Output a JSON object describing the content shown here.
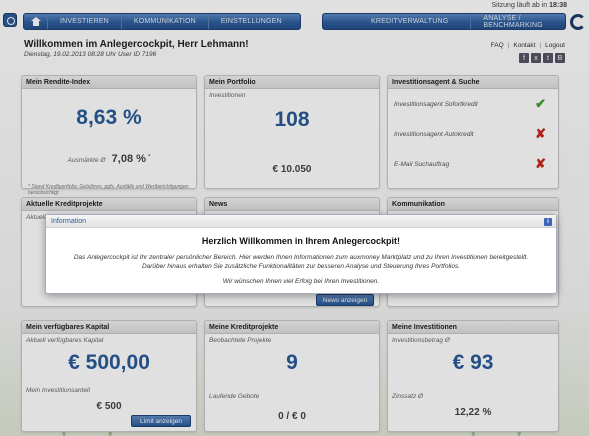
{
  "session": {
    "text": "Sitzung läuft ab in",
    "time": "18:38"
  },
  "nav": {
    "left": [
      "INVESTIEREN",
      "KOMMUNIKATION",
      "EINSTELLUNGEN"
    ],
    "right": [
      "KREDITVERWALTUNG",
      "ANALYSE / BENCHMARKING"
    ]
  },
  "header": {
    "welcome": "Willkommen im Anlegercockpit, Herr Lehmann!",
    "subline": "Dienstag, 19.02.2013 08:28 Uhr    User ID 7196",
    "links": [
      "FAQ",
      "Kontakt",
      "Logout"
    ],
    "social": [
      "f",
      "x",
      "t",
      "B"
    ]
  },
  "cards": {
    "rendite": {
      "title": "Mein Rendite-Index",
      "value": "8,63 %",
      "avg_label": "Ausmärkte Ø",
      "avg_value": "7,08 %",
      "avg_sup": "*",
      "footnote": "* Stand Kreditportfolio; Gebühren, ggfs. Ausfälle und Wertberichtigungen berücksichtigt"
    },
    "portfolio": {
      "title": "Mein Portfolio",
      "label": "Investitionen",
      "count": "108",
      "amount": "€ 10.050"
    },
    "agent": {
      "title": "Investitionsagent & Suche",
      "rows": [
        {
          "label": "Investitionsagent Sofortkredit",
          "status": "check"
        },
        {
          "label": "Investitionsagent Autokredit",
          "status": "cross"
        },
        {
          "label": "E-Mail Suchauftrag",
          "status": "cross"
        }
      ]
    },
    "kreditprojekte": {
      "title": "Aktuelle Kreditprojekte",
      "label": "Aktuell"
    },
    "news": {
      "title": "News",
      "button": "News anzeigen"
    },
    "kommunikation": {
      "title": "Kommunikation"
    },
    "kapital": {
      "title": "Mein verfügbares Kapital",
      "label": "Aktuell verfügbares Kapital",
      "value": "€ 500,00",
      "sub_label": "Mein Investitionsanteil",
      "sub_value": "€ 500",
      "button": "Limit anzeigen"
    },
    "kreditprojekte2": {
      "title": "Meine Kreditprojekte",
      "label": "Beobachtete Projekte",
      "count": "9",
      "sub_label": "Laufende Gebote",
      "sub_value": "0 / € 0"
    },
    "investitionen": {
      "title": "Meine Investitionen",
      "label": "Investitionsbetrag Ø",
      "value": "€ 93",
      "sub_label": "Zinssatz Ø",
      "sub_value": "12,22 %"
    }
  },
  "modal": {
    "header": "Information",
    "title": "Herzlich Willkommen in Ihrem Anlegercockpit!",
    "body": "Das Anlegercockpit ist Ihr zentraler persönlicher Bereich. Hier werden Ihnen Informationen zum auxmoney Marktplatz und zu Ihren Investitionen bereitgestellt. Darüber hinaus erhalten Sie zusätzliche Funktionalitäten zur besseren Analyse und Steuerung Ihres Portfolios.",
    "footer": "Wir wünschen Ihnen viel Erfolg bei Ihren Investitionen."
  }
}
